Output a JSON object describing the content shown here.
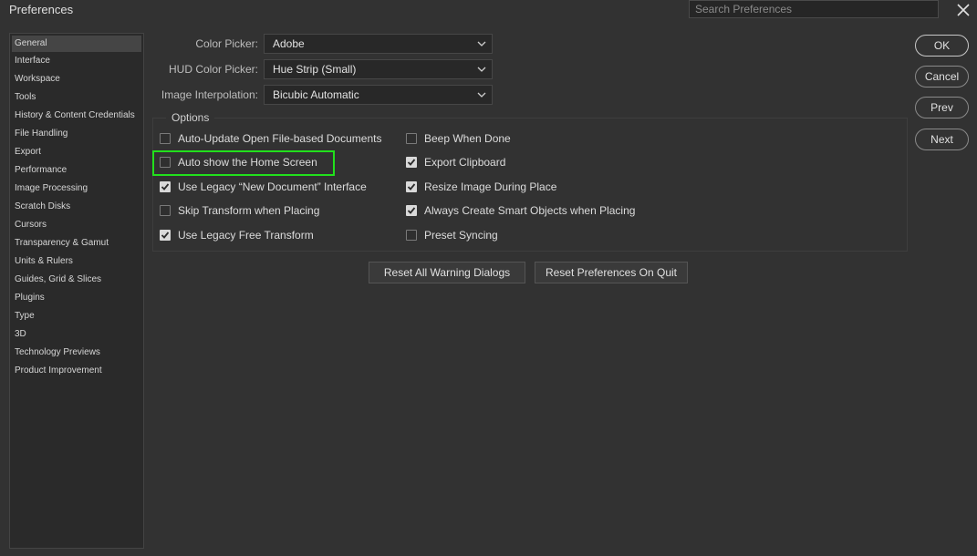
{
  "window": {
    "title": "Preferences",
    "search_placeholder": "Search Preferences"
  },
  "sidebar": {
    "items": [
      {
        "label": "General",
        "active": true
      },
      {
        "label": "Interface"
      },
      {
        "label": "Workspace"
      },
      {
        "label": "Tools"
      },
      {
        "label": "History & Content Credentials"
      },
      {
        "label": "File Handling"
      },
      {
        "label": "Export"
      },
      {
        "label": "Performance"
      },
      {
        "label": "Image Processing"
      },
      {
        "label": "Scratch Disks"
      },
      {
        "label": "Cursors"
      },
      {
        "label": "Transparency & Gamut"
      },
      {
        "label": "Units & Rulers"
      },
      {
        "label": "Guides, Grid & Slices"
      },
      {
        "label": "Plugins"
      },
      {
        "label": "Type"
      },
      {
        "label": "3D"
      },
      {
        "label": "Technology Previews"
      },
      {
        "label": "Product Improvement"
      }
    ]
  },
  "general": {
    "color_picker": {
      "label": "Color Picker:",
      "value": "Adobe"
    },
    "hud_color_picker": {
      "label": "HUD Color Picker:",
      "value": "Hue Strip (Small)"
    },
    "image_interpolation": {
      "label": "Image Interpolation:",
      "value": "Bicubic Automatic"
    }
  },
  "options": {
    "legend": "Options",
    "left": [
      {
        "label": "Auto-Update Open File-based Documents",
        "checked": false
      },
      {
        "label": "Auto show the Home Screen",
        "checked": false
      },
      {
        "label": "Use Legacy “New Document” Interface",
        "checked": true
      },
      {
        "label": "Skip Transform when Placing",
        "checked": false
      },
      {
        "label": "Use Legacy Free Transform",
        "checked": true
      }
    ],
    "right": [
      {
        "label": "Beep When Done",
        "checked": false
      },
      {
        "label": "Export Clipboard",
        "checked": true
      },
      {
        "label": "Resize Image During Place",
        "checked": true
      },
      {
        "label": "Always Create Smart Objects when Placing",
        "checked": true
      },
      {
        "label": "Preset Syncing",
        "checked": false
      }
    ]
  },
  "actions": {
    "reset_warnings": "Reset All Warning Dialogs",
    "reset_prefs": "Reset Preferences On Quit"
  },
  "dialog_buttons": {
    "ok": "OK",
    "cancel": "Cancel",
    "prev": "Prev",
    "next": "Next"
  },
  "colors": {
    "highlight": "#22e01c",
    "background": "#323232"
  }
}
